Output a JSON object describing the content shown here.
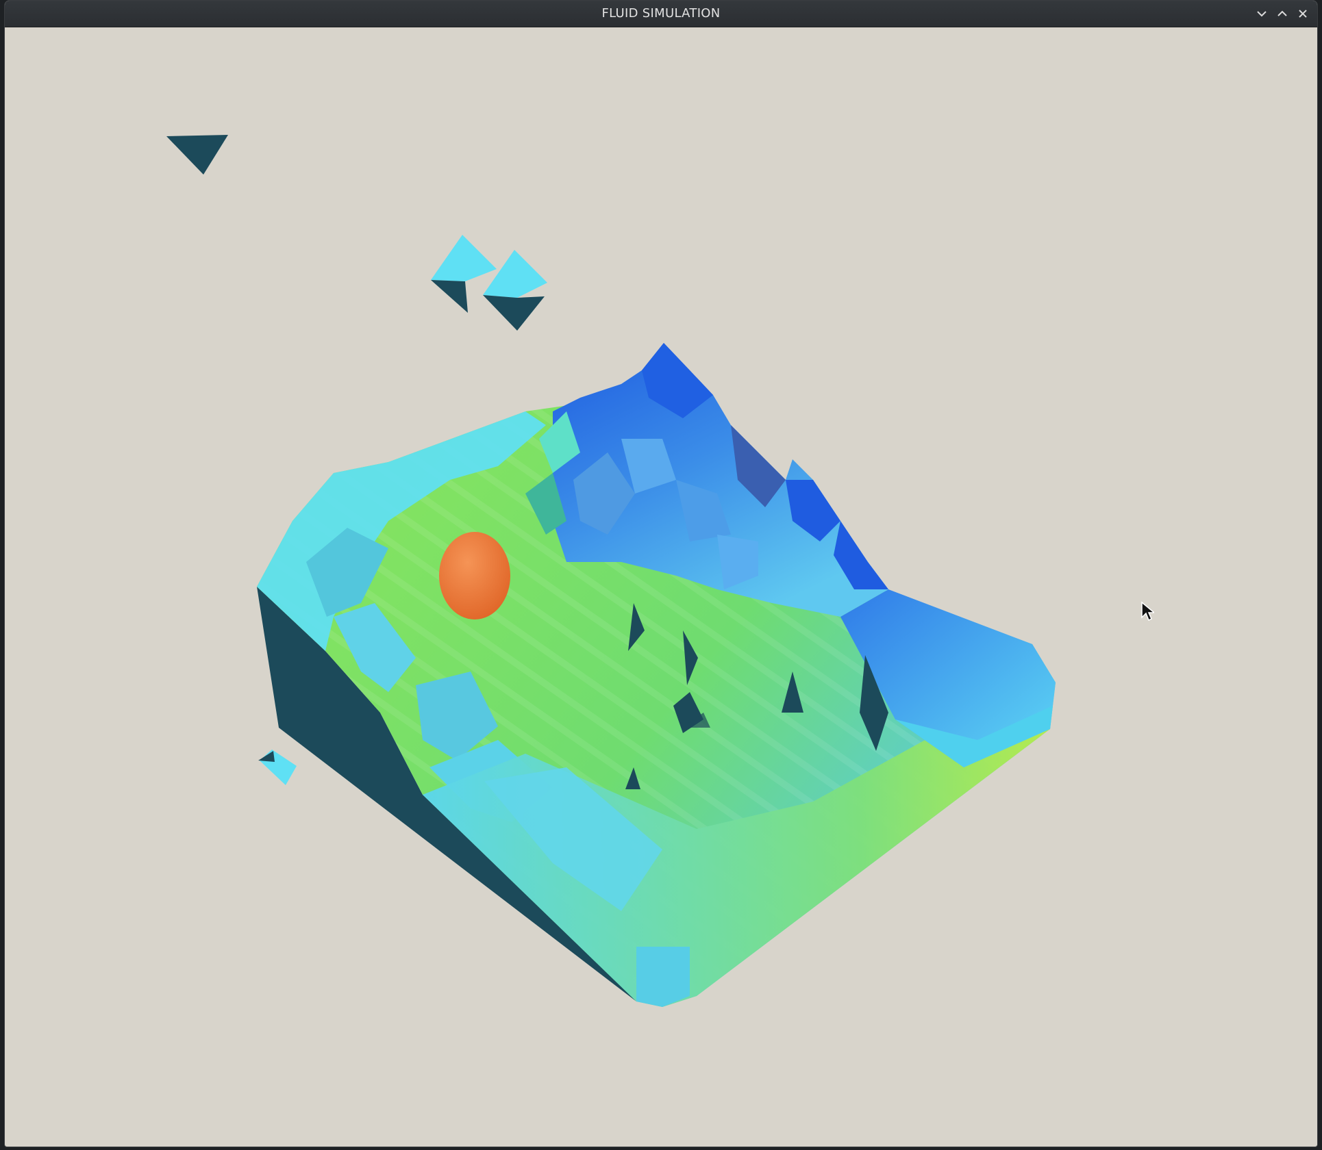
{
  "window": {
    "title": "FLUID SIMULATION",
    "controls": [
      {
        "name": "minimize",
        "icon": "chevron-down-icon"
      },
      {
        "name": "maximize",
        "icon": "chevron-up-icon"
      },
      {
        "name": "close",
        "icon": "close-icon"
      }
    ]
  },
  "scene": {
    "background_color": "#d8d4cb",
    "palette": {
      "shadow": "#1c4a5a",
      "cyan": "#5fe0f4",
      "blue": "#2a72e6",
      "deep_blue": "#1f5ce0",
      "green": "#7fe05a",
      "yellow_green": "#c8f040",
      "sphere": "#ef7a3a"
    },
    "objects": [
      "fluid-mesh",
      "orange-sphere",
      "fluid-droplets"
    ]
  },
  "cursor": {
    "icon": "mouse-pointer-icon"
  }
}
